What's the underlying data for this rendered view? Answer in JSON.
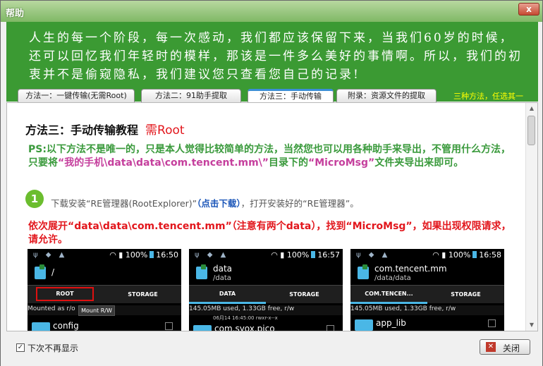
{
  "window": {
    "title": "帮助",
    "close_glyph": "x"
  },
  "banner": {
    "text": "人生的每一个阶段，每一次感动，我们都应该保留下来，当我们60岁的时候，还可以回忆我们年轻时的模样，那该是一件多么美好的事情啊。所以，我们的初衷并不是偷窥隐私，我们建议您只查看您自己的记录!"
  },
  "tabs": [
    {
      "label": "方法一：一键传输(无需Root)"
    },
    {
      "label": "方法二：91助手提取"
    },
    {
      "label": "方法三：手动传输",
      "active": true
    },
    {
      "label": "附录：资源文件的提取"
    }
  ],
  "tab_hint": "三种方法，任选其一",
  "content": {
    "heading": "方法三：手动传输教程",
    "heading_tag": "需Root",
    "ps_1": "PS:以下方法不是唯一的，只是本人觉得比较简单的方法，当然您也可以用各种助手来导出，不管用什么方法，只要将",
    "ps_path": "“我的手机\\data\\data\\com.tencent.mm\\”",
    "ps_2": "目录下的",
    "ps_folder": "“MicroMsg”",
    "ps_3": "文件夹导出来即可。",
    "step_num": "1",
    "step1_a": "下载安装“RE管理器(RootExplorer)”",
    "step1_link": "（点击下载）",
    "step1_b": "，打开安装好的“RE管理器”。",
    "expand": "依次展开“data\\data\\com.tencent.mm”（注意有两个data），找到“MicroMsg”，如果出现权限请求，请允许。"
  },
  "phones": [
    {
      "time": "16:50",
      "battery": "100%",
      "title": "/",
      "sub": "",
      "tab1": "ROOT",
      "tab2": "STORAGE",
      "info": "Mounted as r/o",
      "mount": "Mount R/W",
      "subinfo": "",
      "file": "config"
    },
    {
      "time": "16:57",
      "battery": "100%",
      "title": "data",
      "sub": "/data",
      "tab1": "DATA",
      "tab2": "STORAGE",
      "info": "145.05MB used, 1.33GB free, r/w",
      "subinfo": "06月14 16:45:00    rwxr-x--x",
      "file": "com.syox.pico"
    },
    {
      "time": "16:58",
      "battery": "100%",
      "title": "com.tencent.mm",
      "sub": "/data/data",
      "tab1": "COM.TENCEN...",
      "tab2": "STORAGE",
      "info": "145.05MB used, 1.33GB free, r/w",
      "subinfo": "",
      "file": "app_lib"
    }
  ],
  "footer": {
    "checkbox_label": "下次不再显示",
    "close_label": "关闭",
    "checked": true
  }
}
